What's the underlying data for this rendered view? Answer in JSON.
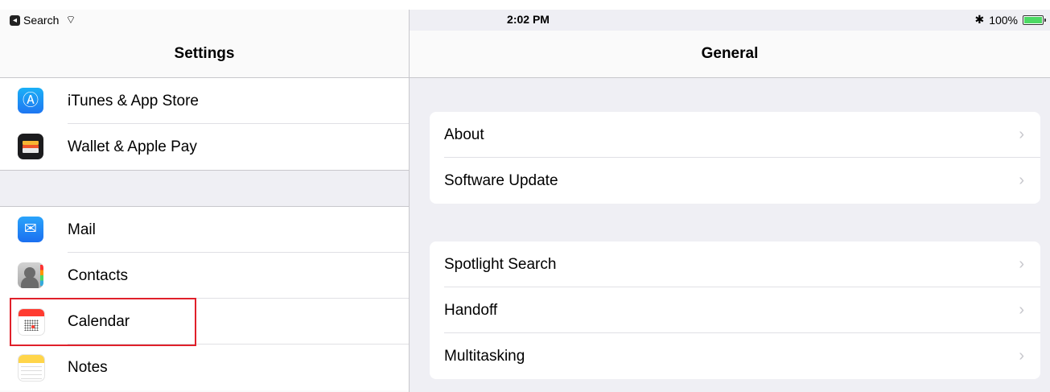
{
  "status_bar": {
    "back_label": "Search",
    "time": "2:02 PM",
    "bluetooth": "✱",
    "battery": "100%",
    "battery_color": "#4cd964"
  },
  "left": {
    "title": "Settings",
    "group1": [
      {
        "label": "iTunes & App Store",
        "icon": "app-store-icon"
      },
      {
        "label": "Wallet & Apple Pay",
        "icon": "wallet-icon"
      }
    ],
    "group2": [
      {
        "label": "Mail",
        "icon": "mail-icon"
      },
      {
        "label": "Contacts",
        "icon": "contacts-icon"
      },
      {
        "label": "Calendar",
        "icon": "calendar-icon"
      },
      {
        "label": "Notes",
        "icon": "notes-icon"
      }
    ],
    "highlight_color": "#e0202a"
  },
  "right": {
    "title": "General",
    "group1": [
      {
        "label": "About"
      },
      {
        "label": "Software Update"
      }
    ],
    "group2": [
      {
        "label": "Spotlight Search"
      },
      {
        "label": "Handoff"
      },
      {
        "label": "Multitasking"
      }
    ],
    "chevron": "›"
  }
}
